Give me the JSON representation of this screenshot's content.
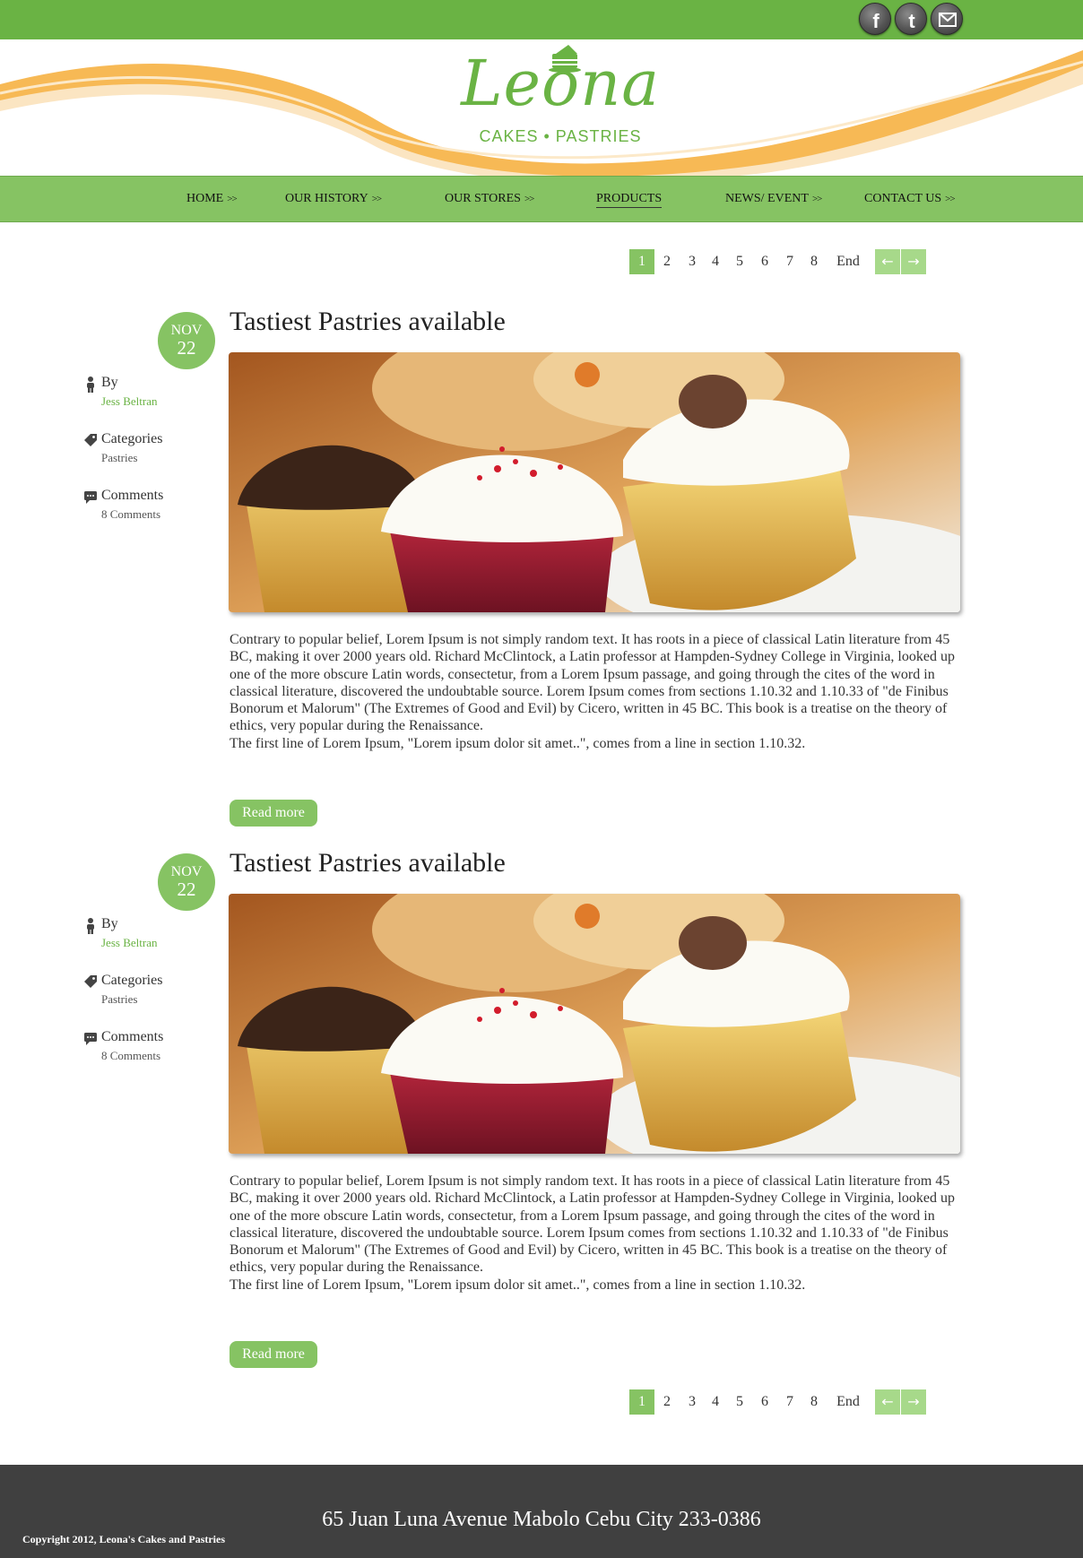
{
  "social": {
    "facebook_icon": "facebook-icon",
    "twitter_icon": "twitter-icon",
    "email_icon": "email-icon"
  },
  "brand": {
    "name": "Leona",
    "tagline": "CAKES • PASTRIES",
    "logo_icon": "cake-icon",
    "accent": "#6ab344",
    "nav_bg": "#86c363",
    "swoosh": "#f7b955"
  },
  "nav": {
    "items": [
      {
        "label": "HOME",
        "arrow": ">>"
      },
      {
        "label": "OUR HISTORY",
        "arrow": ">>"
      },
      {
        "label": "OUR STORES",
        "arrow": ">>"
      },
      {
        "label": "PRODUCTS",
        "arrow": ""
      },
      {
        "label": "NEWS/ EVENT",
        "arrow": ">>"
      },
      {
        "label": "CONTACT US",
        "arrow": ">>"
      }
    ],
    "active": "PRODUCTS"
  },
  "pagination": {
    "pages": [
      "1",
      "2",
      "3",
      "4",
      "5",
      "6",
      "7",
      "8"
    ],
    "current": "1",
    "end_label": "End",
    "prev_icon": "arrow-left-icon",
    "next_icon": "arrow-right-icon",
    "prev_glyph": "←",
    "next_glyph": "→"
  },
  "posts": [
    {
      "month": "NOV",
      "day": "22",
      "title": "Tastiest Pastries available",
      "by_label": "By",
      "author": "Jess Beltran",
      "categories_label": "Categories",
      "category": "Pastries",
      "comments_label": "Comments",
      "comments": "8 Comments",
      "body": "Contrary to popular belief, Lorem Ipsum is not simply random text. It has roots in a piece of classical Latin literature from 45 BC, making it over 2000 years old. Richard McClintock, a Latin professor at Hampden-Sydney College in Virginia, looked up one of the more obscure Latin words, consectetur, from a Lorem Ipsum passage, and going through the cites of the word in classical literature, discovered the undoubtable source. Lorem Ipsum comes from sections 1.10.32 and 1.10.33 of \"de Finibus Bonorum et Malorum\" (The Extremes of Good and Evil) by Cicero, written in 45 BC. This book is a treatise on the theory of ethics, very popular during the Renaissance.",
      "body2": "The first line of Lorem Ipsum, \"Lorem ipsum dolor sit amet..\", comes from a line in section 1.10.32.",
      "read_more": "Read more"
    },
    {
      "month": "NOV",
      "day": "22",
      "title": "Tastiest Pastries available",
      "by_label": "By",
      "author": "Jess Beltran",
      "categories_label": "Categories",
      "category": "Pastries",
      "comments_label": "Comments",
      "comments": "8 Comments",
      "body": "Contrary to popular belief, Lorem Ipsum is not simply random text. It has roots in a piece of classical Latin literature from 45 BC, making it over 2000 years old. Richard McClintock, a Latin professor at Hampden-Sydney College in Virginia, looked up one of the more obscure Latin words, consectetur, from a Lorem Ipsum passage, and going through the cites of the word in classical literature, discovered the undoubtable source. Lorem Ipsum comes from sections 1.10.32 and 1.10.33 of \"de Finibus Bonorum et Malorum\" (The Extremes of Good and Evil) by Cicero, written in 45 BC. This book is a treatise on the theory of ethics, very popular during the Renaissance.",
      "body2": "The first line of Lorem Ipsum, \"Lorem ipsum dolor sit amet..\", comes from a line in section 1.10.32.",
      "read_more": "Read more"
    }
  ],
  "footer": {
    "address": "65 Juan Luna Avenue Mabolo Cebu City 233-0386",
    "copyright": "Copyright 2012, Leona's Cakes and Pastries"
  }
}
